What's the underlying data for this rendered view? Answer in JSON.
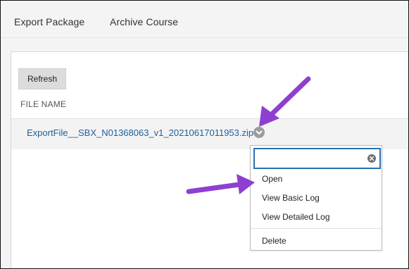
{
  "tabs": [
    {
      "label": "Export Package"
    },
    {
      "label": "Archive Course"
    }
  ],
  "toolbar": {
    "refresh_label": "Refresh"
  },
  "table": {
    "column_header": "FILE NAME",
    "rows": [
      {
        "file_name": "ExportFile__SBX_N01368063_v1_20210617011953.zip"
      }
    ]
  },
  "context_menu": {
    "search_value": "",
    "items": [
      {
        "label": "Open"
      },
      {
        "label": "View Basic Log"
      },
      {
        "label": "View Detailed Log"
      },
      {
        "label": "Delete"
      }
    ]
  },
  "icons": {
    "chevron": "chevron-down-icon",
    "clear": "clear-icon",
    "annotation_arrow": "arrow-icon"
  },
  "colors": {
    "link": "#1f5f9b",
    "accent_border": "#2a6fb5",
    "annotation_arrow": "#8e3fd0"
  }
}
